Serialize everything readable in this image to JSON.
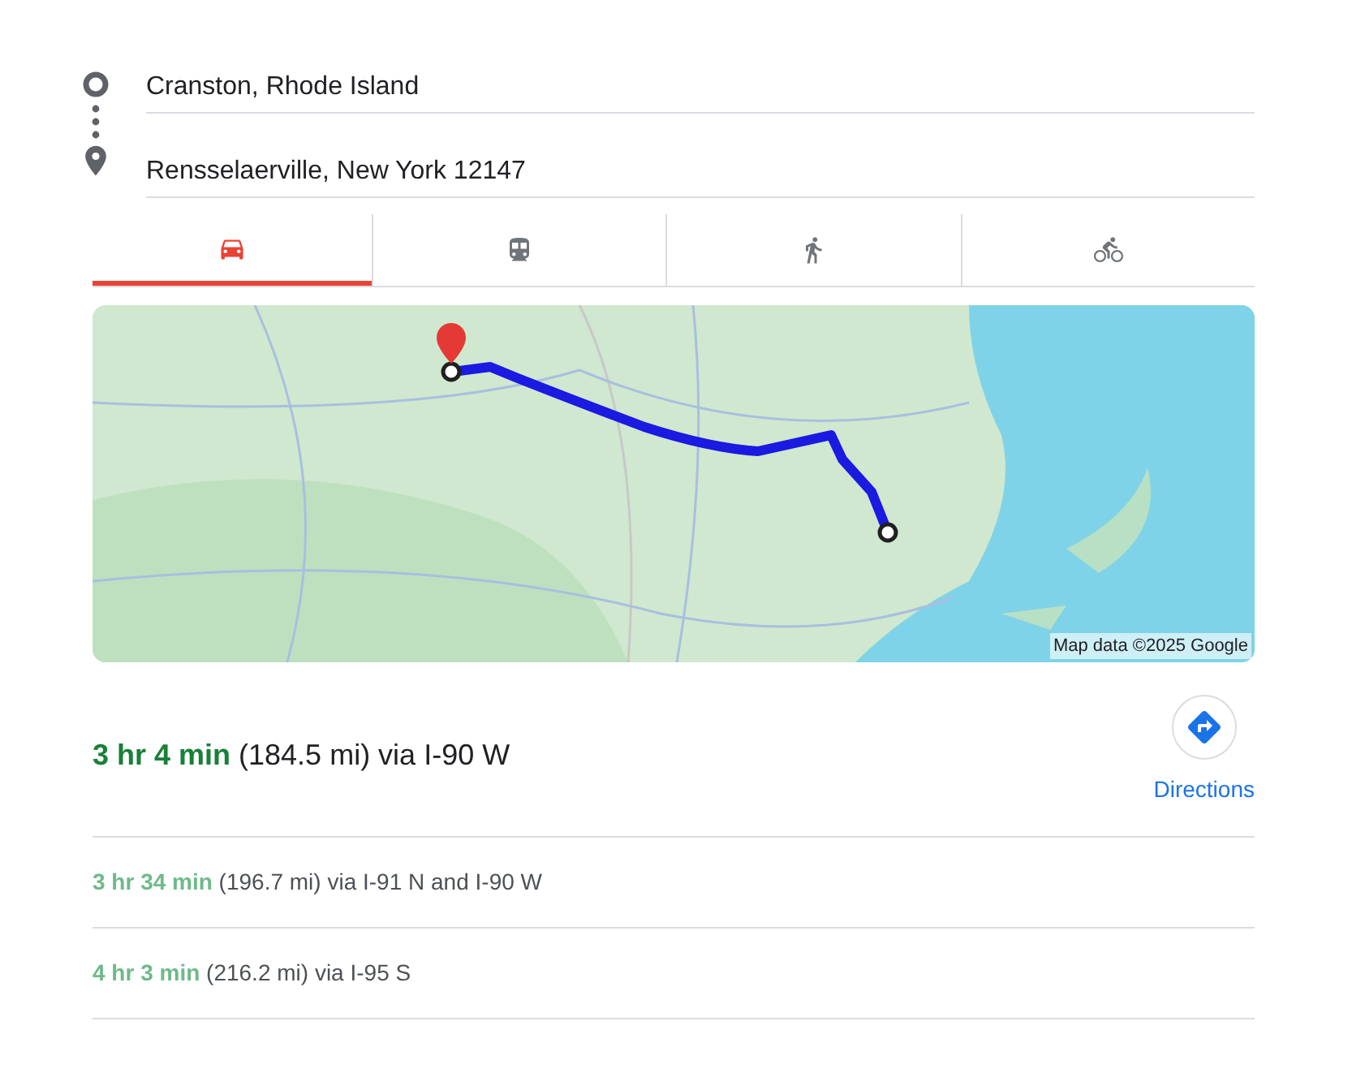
{
  "origin": {
    "value": "Cranston, Rhode Island"
  },
  "destination": {
    "value": "Rensselaerville, New York 12147"
  },
  "tabs": [
    {
      "kind": "car",
      "selected": true
    },
    {
      "kind": "transit",
      "selected": false
    },
    {
      "kind": "walk",
      "selected": false
    },
    {
      "kind": "bike",
      "selected": false
    }
  ],
  "map": {
    "kind": "picture",
    "attribution": "Map data ©2025 Google"
  },
  "best_route": {
    "text": "**3 hr 4 min** (184.5 mi) via I-90 W"
  },
  "directions_button": {
    "label": "Directions"
  },
  "alternatives": [
    {
      "text": "**3 hr 34 min** (196.7 mi) via I-91 N and I-90 W"
    },
    {
      "text": "**4 hr 3 min** (216.2 mi) via I-95 S"
    }
  ]
}
